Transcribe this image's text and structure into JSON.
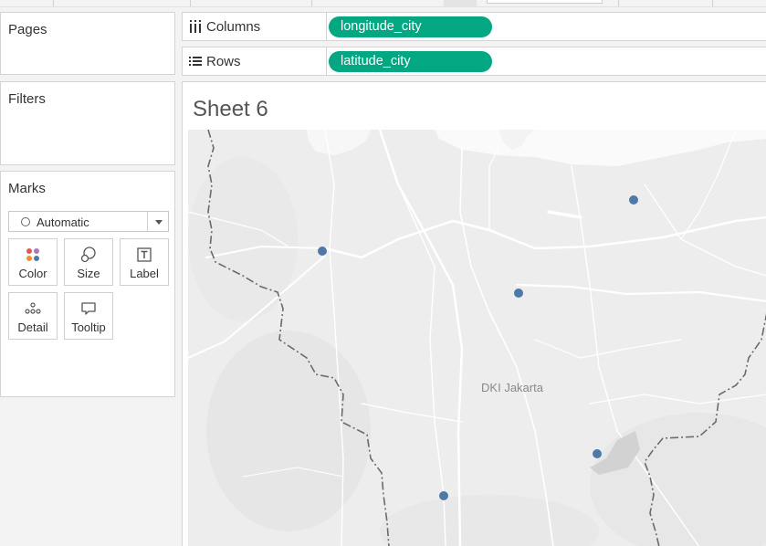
{
  "cards": {
    "pages_title": "Pages",
    "filters_title": "Filters",
    "marks": {
      "title": "Marks",
      "type_selected": "Automatic",
      "buttons": [
        {
          "label": "Color",
          "icon": "color-dots-icon"
        },
        {
          "label": "Size",
          "icon": "size-circles-icon"
        },
        {
          "label": "Label",
          "icon": "label-text-icon"
        },
        {
          "label": "Detail",
          "icon": "detail-dots-icon"
        },
        {
          "label": "Tooltip",
          "icon": "tooltip-bubble-icon"
        }
      ]
    }
  },
  "shelves": {
    "columns": {
      "label": "Columns",
      "icon": "columns-icon",
      "pill": "longitude_city"
    },
    "rows": {
      "label": "Rows",
      "icon": "rows-icon",
      "pill": "latitude_city"
    }
  },
  "sheet": {
    "title": "Sheet 6",
    "map_label": "DKI Jakarta"
  },
  "colors": {
    "pill_green": "#03a883",
    "mark_blue": "#4e79a7",
    "map_background": "#ededed"
  }
}
